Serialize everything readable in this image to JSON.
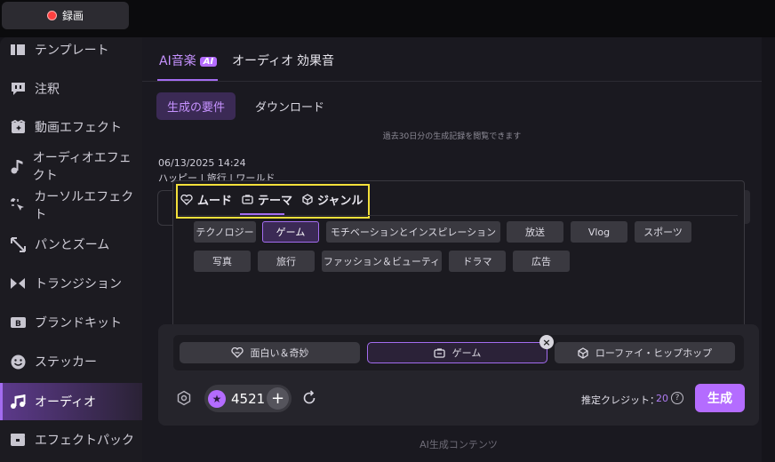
{
  "record_button": {
    "label": "録画"
  },
  "sidebar": {
    "items": [
      {
        "id": "template",
        "label": "テンプレート",
        "icon": "template-icon"
      },
      {
        "id": "annotation",
        "label": "注釈",
        "icon": "annotation-icon"
      },
      {
        "id": "video-effect",
        "label": "動画エフェクト",
        "icon": "video-effect-icon"
      },
      {
        "id": "audio-effect",
        "label": "オーディオエフェクト",
        "icon": "music-note-icon"
      },
      {
        "id": "cursor-effect",
        "label": "カーソルエフェクト",
        "icon": "cursor-sparkle-icon"
      },
      {
        "id": "pan-zoom",
        "label": "パンとズーム",
        "icon": "pan-zoom-icon"
      },
      {
        "id": "transition",
        "label": "トランジション",
        "icon": "transition-icon"
      },
      {
        "id": "brand-kit",
        "label": "ブランドキット",
        "icon": "brand-kit-icon"
      },
      {
        "id": "sticker",
        "label": "ステッカー",
        "icon": "sticker-icon"
      },
      {
        "id": "audio",
        "label": "オーディオ",
        "icon": "audio-icon",
        "active": true
      },
      {
        "id": "effect-pack",
        "label": "エフェクトパック",
        "icon": "effect-pack-icon"
      }
    ]
  },
  "main": {
    "tabs": [
      {
        "label": "AI音楽",
        "badge": "AI",
        "active": true
      },
      {
        "label": "オーディオ"
      },
      {
        "label": "効果音"
      }
    ],
    "subtabs": [
      {
        "label": "生成の要件",
        "active": true
      },
      {
        "label": "ダウンロード"
      }
    ],
    "history_note": "過去30日分の生成記録を閲覧できます",
    "entry": {
      "date": "06/13/2025 14:24",
      "tags": "ハッピー | 旅行 | ワールド"
    }
  },
  "popup": {
    "category_tabs": [
      {
        "label": "ムード",
        "icon": "mood-icon"
      },
      {
        "label": "テーマ",
        "icon": "theme-icon",
        "active": true
      },
      {
        "label": "ジャンル",
        "icon": "genre-icon"
      }
    ],
    "chips": [
      {
        "label": "テクノロジー"
      },
      {
        "label": "ゲーム",
        "selected": true
      },
      {
        "label": "モチベーションとインスピレーション"
      },
      {
        "label": "放送"
      },
      {
        "label": "Vlog"
      },
      {
        "label": "スポーツ"
      },
      {
        "label": "写真"
      },
      {
        "label": "旅行"
      },
      {
        "label": "ファッション＆ビューティ"
      },
      {
        "label": "ドラマ"
      },
      {
        "label": "広告"
      }
    ]
  },
  "selection": {
    "slots": [
      {
        "label": "面白い＆奇妙",
        "icon": "mood-icon"
      },
      {
        "label": "ゲーム",
        "icon": "theme-icon",
        "selected": true
      },
      {
        "label": "ローファイ・ヒップホップ",
        "icon": "genre-icon"
      }
    ],
    "close": "×"
  },
  "controls": {
    "credits": "4521",
    "plus": "+",
    "estimate_label": "推定クレジット：",
    "estimate_value": "20",
    "help": "?",
    "generate_label": "生成"
  },
  "footer_note": "AI生成コンテンツ",
  "colors": {
    "accent": "#b46cff",
    "highlight_box": "#f3e03a",
    "record": "#ff4040"
  }
}
